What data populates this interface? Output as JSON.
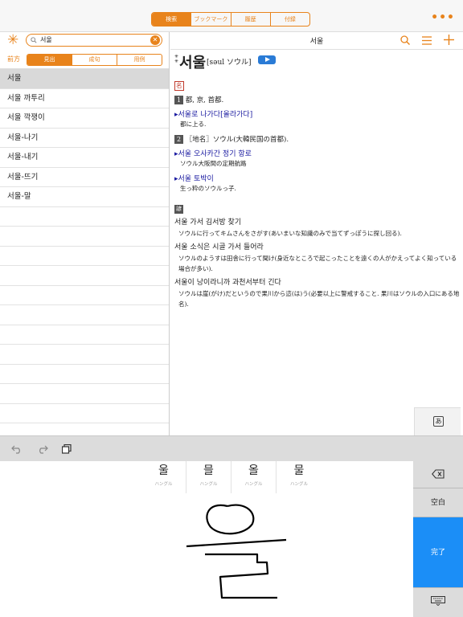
{
  "top_tabs": [
    "検索",
    "ブックマーク",
    "履歴",
    "付録"
  ],
  "active_tab": 0,
  "search": {
    "value": "서울"
  },
  "mode_label": "前方",
  "mode_tabs": [
    "見出",
    "成句",
    "用例"
  ],
  "results": [
    "서울",
    "서울 까투리",
    "서울 깍쟁이",
    "서울-나기",
    "서울-내기",
    "서울-뜨기",
    "서울-말"
  ],
  "entry": {
    "header_title": "서울",
    "headword": "서울",
    "mark": "✳",
    "mark2": "✳",
    "pron": "[səul ソウル]",
    "pos": "名",
    "sense1_num": "1",
    "sense1": "都, 京, 首都.",
    "ex1_ko": "서울로 나가다[올라가다]",
    "ex1_ja": "都に上る.",
    "sense2_num": "2",
    "sense2": "〖地名〗ソウル(大韓民国の首都).",
    "ex2_ko": "서울 오사카간 정기 항로",
    "ex2_ja": "ソウル大阪間の定期航路",
    "ex3_ko": "서울 토박이",
    "ex3_ja": "生っ粋のソウルっ子.",
    "idiom_mark": "諺",
    "idioms": [
      {
        "ko": "서울 가서 김서방 찾기",
        "ja": "ソウルに行ってキムさんをさがす(あいまいな知識のみで当てずっぽうに探し回る)."
      },
      {
        "ko": "서울 소식은 시골 가서 들어라",
        "ja": "ソウルのようすは田舎に行って聞け(身近なところで起こったことを遠くの人がかえってよく知っている場合が多い)."
      },
      {
        "ko": "서울이 낭이라니까 과천서부터 긴다",
        "ja": "ソウルは崖(がけ)だというので果川から這(は)う(必要以上に警戒すること. 果川はソウルの入口にある地名)."
      }
    ]
  },
  "a_button": "あ",
  "candidates": [
    {
      "ch": "울",
      "sub": "ハングル"
    },
    {
      "ch": "믈",
      "sub": "ハングル"
    },
    {
      "ch": "올",
      "sub": "ハングル"
    },
    {
      "ch": "물",
      "sub": "ハングル"
    }
  ],
  "keys": {
    "space": "空白",
    "done": "完了"
  },
  "colors": {
    "accent": "#e8831b",
    "done": "#1b8ef7"
  }
}
